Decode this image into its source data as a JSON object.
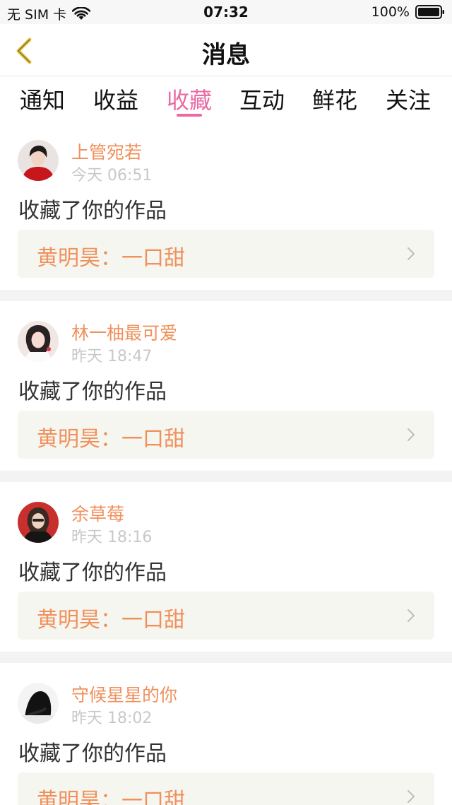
{
  "status_bar": {
    "carrier": "无 SIM 卡",
    "time": "07:32",
    "battery_percent": "100%"
  },
  "nav": {
    "title": "消息"
  },
  "tabs": [
    {
      "label": "通知",
      "active": false
    },
    {
      "label": "收益",
      "active": false
    },
    {
      "label": "收藏",
      "active": true
    },
    {
      "label": "互动",
      "active": false
    },
    {
      "label": "鲜花",
      "active": false
    },
    {
      "label": "关注",
      "active": false
    }
  ],
  "messages": [
    {
      "username": "上管宛若",
      "time": "今天 06:51",
      "action": "收藏了你的作品",
      "work": "黄明昊：一口甜"
    },
    {
      "username": "林一柚最可爱",
      "time": "昨天 18:47",
      "action": "收藏了你的作品",
      "work": "黄明昊：一口甜"
    },
    {
      "username": "余草莓",
      "time": "昨天 18:16",
      "action": "收藏了你的作品",
      "work": "黄明昊：一口甜"
    },
    {
      "username": "守候星星的你",
      "time": "昨天 18:02",
      "action": "收藏了你的作品",
      "work": "黄明昊：一口甜"
    }
  ],
  "colors": {
    "accent_pink": "#ea6aa3",
    "username_orange": "#f0905c",
    "back_arrow_yellow": "#e8c43a"
  }
}
